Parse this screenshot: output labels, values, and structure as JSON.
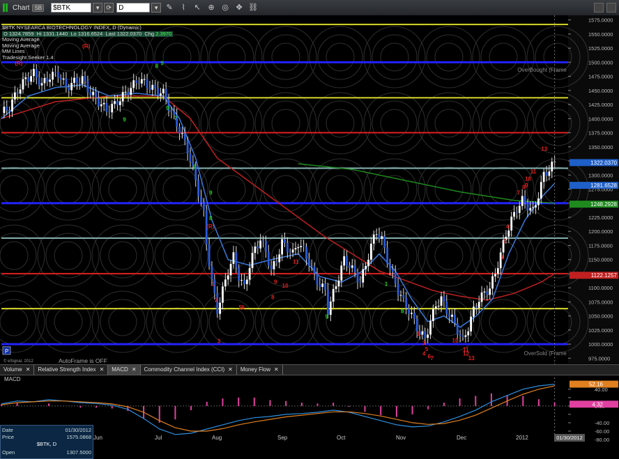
{
  "window": {
    "title": "Chart",
    "badge": "SB",
    "symbol": "$BTK",
    "interval": "D",
    "tools": [
      "pencil-icon",
      "brush-icon",
      "cursor-icon",
      "magnify-icon",
      "target-icon",
      "crosshair-icon",
      "link-icon"
    ]
  },
  "info_panel": {
    "header": "$BTK NYSEARCA BIOTECHNOLOGY INDEX, D (Dynamic)",
    "ohlc_labels": {
      "o": "O",
      "hi": "Hi",
      "lo": "Lo",
      "last": "Last",
      "chg": "Chg"
    },
    "ohlc_values": {
      "o": "1324.7859",
      "hi": "1331.1440",
      "lo": "1316.6524",
      "last": "1322.0370",
      "chg": "2.3970"
    },
    "studies": [
      "Moving Average",
      "Moving Average",
      "MM Lines",
      "Tradesight Seeker 1.4"
    ]
  },
  "annotations": {
    "overbought": "OverBought (Frame",
    "oversold": "OverSold (Frame",
    "autoframe": "AutoFrame is OFF",
    "copyright": "© eSignal, 2012",
    "p_button": "P"
  },
  "chart_data": [
    {
      "type": "candlestick",
      "title": "$BTK NYSEARCA BIOTECHNOLOGY INDEX, D (Dynamic)",
      "x_tick_labels": [
        "Jun",
        "Jul",
        "Aug",
        "Sep",
        "Oct",
        "Nov",
        "Dec",
        "2012"
      ],
      "y_ticks": [
        1575,
        1550,
        1525,
        1500,
        1475,
        1450,
        1425,
        1400,
        1375,
        1350,
        1325,
        1300,
        1275,
        1250,
        1225,
        1200,
        1175,
        1150,
        1125,
        1100,
        1075,
        1050,
        1025,
        1000,
        975
      ],
      "y_tick_labels": [
        "1575.0000",
        "1550.0000",
        "1525.0000",
        "1500.0000",
        "1475.0000",
        "1450.0000",
        "1425.0000",
        "1400.0000",
        "1375.0000",
        "1350.0000",
        "1325.0000",
        "1300.0000",
        "1275.0000",
        "1250.0000",
        "1225.0000",
        "1200.0000",
        "1175.0000",
        "1150.0000",
        "1125.0000",
        "1100.0000",
        "1075.0000",
        "1050.0000",
        "1025.0000",
        "1000.0000",
        "975.0000"
      ],
      "ylim": [
        968,
        1582
      ],
      "close_path": [
        [
          0,
          1410
        ],
        [
          3,
          1420
        ],
        [
          6,
          1450
        ],
        [
          9,
          1470
        ],
        [
          12,
          1480
        ],
        [
          15,
          1460
        ],
        [
          18,
          1475
        ],
        [
          21,
          1480
        ],
        [
          24,
          1455
        ],
        [
          27,
          1465
        ],
        [
          30,
          1470
        ],
        [
          33,
          1445
        ],
        [
          36,
          1430
        ],
        [
          39,
          1415
        ],
        [
          42,
          1425
        ],
        [
          45,
          1440
        ],
        [
          48,
          1455
        ],
        [
          51,
          1470
        ],
        [
          54,
          1460
        ],
        [
          57,
          1450
        ],
        [
          60,
          1445
        ],
        [
          63,
          1410
        ],
        [
          66,
          1380
        ],
        [
          69,
          1345
        ],
        [
          72,
          1290
        ],
        [
          75,
          1230
        ],
        [
          76,
          1180
        ],
        [
          78,
          1110
        ],
        [
          80,
          1060
        ],
        [
          82,
          1095
        ],
        [
          84,
          1130
        ],
        [
          86,
          1155
        ],
        [
          88,
          1120
        ],
        [
          90,
          1100
        ],
        [
          92,
          1140
        ],
        [
          94,
          1170
        ],
        [
          96,
          1185
        ],
        [
          98,
          1165
        ],
        [
          100,
          1130
        ],
        [
          102,
          1150
        ],
        [
          104,
          1180
        ],
        [
          106,
          1170
        ],
        [
          108,
          1160
        ],
        [
          110,
          1180
        ],
        [
          112,
          1165
        ],
        [
          114,
          1145
        ],
        [
          116,
          1120
        ],
        [
          118,
          1105
        ],
        [
          120,
          1095
        ],
        [
          121,
          1060
        ],
        [
          123,
          1090
        ],
        [
          125,
          1120
        ],
        [
          127,
          1150
        ],
        [
          129,
          1140
        ],
        [
          131,
          1125
        ],
        [
          133,
          1110
        ],
        [
          135,
          1140
        ],
        [
          137,
          1175
        ],
        [
          139,
          1200
        ],
        [
          141,
          1185
        ],
        [
          143,
          1150
        ],
        [
          145,
          1120
        ],
        [
          147,
          1095
        ],
        [
          149,
          1075
        ],
        [
          151,
          1060
        ],
        [
          153,
          1040
        ],
        [
          155,
          1020
        ],
        [
          157,
          1010
        ],
        [
          159,
          1040
        ],
        [
          161,
          1070
        ],
        [
          163,
          1080
        ],
        [
          165,
          1060
        ],
        [
          167,
          1045
        ],
        [
          169,
          1025
        ],
        [
          171,
          1005
        ],
        [
          173,
          1030
        ],
        [
          175,
          1060
        ],
        [
          177,
          1080
        ],
        [
          179,
          1090
        ],
        [
          181,
          1100
        ],
        [
          183,
          1125
        ],
        [
          185,
          1160
        ],
        [
          187,
          1195
        ],
        [
          189,
          1220
        ],
        [
          191,
          1240
        ],
        [
          193,
          1255
        ],
        [
          195,
          1245
        ],
        [
          197,
          1235
        ],
        [
          199,
          1265
        ],
        [
          201,
          1300
        ],
        [
          203,
          1310
        ],
        [
          205,
          1322
        ]
      ],
      "horizontal_lines": [
        {
          "value": 1567,
          "color": "#d9d92a"
        },
        {
          "value": 1500,
          "color": "#2222ff"
        },
        {
          "value": 1437,
          "color": "#d9d92a"
        },
        {
          "value": 1375,
          "color": "#e02020"
        },
        {
          "value": 1312,
          "color": "#88b4b4"
        },
        {
          "value": 1250,
          "color": "#2222ff"
        },
        {
          "value": 1188,
          "color": "#88b4b4"
        },
        {
          "value": 1125,
          "color": "#e02020"
        },
        {
          "value": 1063,
          "color": "#d9d92a"
        },
        {
          "value": 1000,
          "color": "#2222ff"
        }
      ],
      "moving_averages": [
        {
          "color": "#c02020",
          "points": [
            [
              0,
              1400
            ],
            [
              20,
              1430
            ],
            [
              40,
              1440
            ],
            [
              60,
              1440
            ],
            [
              70,
              1400
            ],
            [
              80,
              1330
            ],
            [
              100,
              1260
            ],
            [
              120,
              1190
            ],
            [
              140,
              1130
            ],
            [
              160,
              1095
            ],
            [
              170,
              1085
            ],
            [
              180,
              1078
            ],
            [
              190,
              1090
            ],
            [
              200,
              1110
            ],
            [
              205,
              1125
            ]
          ]
        },
        {
          "color": "#1e8a1e",
          "points": [
            [
              110,
              1320
            ],
            [
              130,
              1310
            ],
            [
              150,
              1290
            ],
            [
              170,
              1270
            ],
            [
              190,
              1255
            ],
            [
              205,
              1250
            ]
          ]
        },
        {
          "color": "#3a7ad8",
          "points": [
            [
              0,
              1400
            ],
            [
              10,
              1440
            ],
            [
              20,
              1455
            ],
            [
              30,
              1460
            ],
            [
              40,
              1440
            ],
            [
              50,
              1445
            ],
            [
              60,
              1440
            ],
            [
              66,
              1400
            ],
            [
              72,
              1330
            ],
            [
              78,
              1220
            ],
            [
              84,
              1150
            ],
            [
              92,
              1140
            ],
            [
              100,
              1150
            ],
            [
              110,
              1160
            ],
            [
              118,
              1120
            ],
            [
              126,
              1110
            ],
            [
              134,
              1130
            ],
            [
              140,
              1160
            ],
            [
              146,
              1130
            ],
            [
              152,
              1080
            ],
            [
              158,
              1040
            ],
            [
              164,
              1050
            ],
            [
              170,
              1030
            ],
            [
              176,
              1050
            ],
            [
              182,
              1080
            ],
            [
              188,
              1160
            ],
            [
              194,
              1220
            ],
            [
              200,
              1260
            ],
            [
              205,
              1285
            ]
          ]
        }
      ],
      "price_labels": [
        {
          "text": "1322.0370",
          "value": 1322.037,
          "bg": "#1f5fc8",
          "fg": "#ffffff"
        },
        {
          "text": "1281.6528",
          "value": 1281.6528,
          "bg": "#1f5fc8",
          "fg": "#ffffff"
        },
        {
          "text": "1248.2928",
          "value": 1248.2928,
          "bg": "#1e8a1e",
          "fg": "#ffffff"
        },
        {
          "text": "1122.1257",
          "value": 1122.1257,
          "bg": "#c02020",
          "fg": "#ffffff"
        }
      ],
      "seeker_counts": [
        {
          "text": "(R)",
          "x": 30,
          "value": 1525,
          "color": "#e02020"
        },
        {
          "text": "(R)",
          "x": 5,
          "value": 1495,
          "color": "#e02020"
        },
        {
          "text": "8",
          "x": 57,
          "value": 1490,
          "color": "#22cc22"
        },
        {
          "text": "9",
          "x": 59,
          "value": 1495,
          "color": "#22cc22"
        },
        {
          "text": "7",
          "x": 64,
          "value": 1397,
          "color": "#22cc22"
        },
        {
          "text": "9",
          "x": 45,
          "value": 1395,
          "color": "#22cc22"
        },
        {
          "text": "9",
          "x": 61,
          "value": 1415,
          "color": "#22cc22"
        },
        {
          "text": "9",
          "x": 71,
          "value": 1311,
          "color": "#22cc22"
        },
        {
          "text": "9",
          "x": 77,
          "value": 1265,
          "color": "#22cc22"
        },
        {
          "text": "8",
          "x": 77,
          "value": 1220,
          "color": "#22cc22"
        },
        {
          "text": "(R)",
          "x": 76,
          "value": 1205,
          "color": "#e02020"
        },
        {
          "text": "1",
          "x": 78,
          "value": 1103,
          "color": "#e02020"
        },
        {
          "text": "2",
          "x": 79,
          "value": 1075,
          "color": "#e02020"
        },
        {
          "text": "3",
          "x": 80,
          "value": 1002,
          "color": "#e02020"
        },
        {
          "text": "5",
          "x": 88,
          "value": 1062,
          "color": "#e02020"
        },
        {
          "text": "6",
          "x": 89,
          "value": 1062,
          "color": "#e02020"
        },
        {
          "text": "8",
          "x": 100,
          "value": 1080,
          "color": "#e02020"
        },
        {
          "text": "9",
          "x": 101,
          "value": 1107,
          "color": "#e02020"
        },
        {
          "text": "10",
          "x": 104,
          "value": 1100,
          "color": "#e02020"
        },
        {
          "text": "11",
          "x": 108,
          "value": 1143,
          "color": "#e02020"
        },
        {
          "text": "9",
          "x": 120,
          "value": 1045,
          "color": "#22cc22"
        },
        {
          "text": "1",
          "x": 142,
          "value": 1103,
          "color": "#22cc22"
        },
        {
          "text": "8",
          "x": 148,
          "value": 1055,
          "color": "#22cc22"
        },
        {
          "text": "1",
          "x": 154,
          "value": 1015,
          "color": "#e02020"
        },
        {
          "text": "3",
          "x": 156,
          "value": 998,
          "color": "#e02020"
        },
        {
          "text": "5",
          "x": 157,
          "value": 988,
          "color": "#e02020"
        },
        {
          "text": "4",
          "x": 156,
          "value": 980,
          "color": "#e02020"
        },
        {
          "text": "6",
          "x": 158,
          "value": 975,
          "color": "#e02020"
        },
        {
          "text": "7",
          "x": 159,
          "value": 972,
          "color": "#e02020"
        },
        {
          "text": "10",
          "x": 167,
          "value": 1003,
          "color": "#e02020"
        },
        {
          "text": "11",
          "x": 171,
          "value": 987,
          "color": "#e02020"
        },
        {
          "text": "12",
          "x": 171,
          "value": 980,
          "color": "#e02020"
        },
        {
          "text": "13",
          "x": 173,
          "value": 972,
          "color": "#e02020"
        },
        {
          "text": "1",
          "x": 185,
          "value": 1150,
          "color": "#e02020"
        },
        {
          "text": "3",
          "x": 186,
          "value": 1180,
          "color": "#e02020"
        },
        {
          "text": "4",
          "x": 187,
          "value": 1205,
          "color": "#e02020"
        },
        {
          "text": "7",
          "x": 191,
          "value": 1265,
          "color": "#e02020"
        },
        {
          "text": "8",
          "x": 193,
          "value": 1275,
          "color": "#e02020"
        },
        {
          "text": "9",
          "x": 194,
          "value": 1278,
          "color": "#e02020"
        },
        {
          "text": "10",
          "x": 194,
          "value": 1290,
          "color": "#e02020"
        },
        {
          "text": "11",
          "x": 196,
          "value": 1303,
          "color": "#e02020"
        },
        {
          "text": "13",
          "x": 200,
          "value": 1343,
          "color": "#e02020"
        }
      ]
    },
    {
      "type": "line",
      "title": "MACD",
      "series": [
        {
          "color": "#2f8fe0",
          "values": [
            5,
            12,
            10,
            15,
            12,
            8,
            6,
            2,
            -8,
            -30,
            -55,
            -68,
            -65,
            -55,
            -45,
            -35,
            -28,
            -25,
            -20,
            -18,
            -15,
            -10,
            -15,
            -25,
            -35,
            -45,
            -50,
            -48,
            -38,
            -25,
            -10,
            10,
            25,
            40,
            48,
            52
          ]
        },
        {
          "color": "#e08020",
          "values": [
            3,
            8,
            10,
            12,
            12,
            10,
            8,
            5,
            -2,
            -15,
            -35,
            -52,
            -60,
            -60,
            -54,
            -45,
            -38,
            -32,
            -26,
            -22,
            -18,
            -14,
            -14,
            -18,
            -24,
            -32,
            -40,
            -44,
            -42,
            -34,
            -22,
            -5,
            12,
            28,
            40,
            48
          ]
        }
      ],
      "histogram_color": "#e040a0",
      "y_ticks": [
        40,
        20,
        0,
        -20,
        -40,
        -60,
        -80
      ],
      "y_tick_labels": [
        "40.00",
        "",
        "0.00",
        "",
        "-40.00",
        "-60.00",
        "-80.00"
      ],
      "ylim": [
        -90,
        58
      ],
      "price_labels": [
        {
          "text": "52.16",
          "value": 52.16,
          "bg": "#e08020",
          "fg": "#ffffff"
        },
        {
          "text": "4.32",
          "value": 4.32,
          "bg": "#e040a0",
          "fg": "#ffffff"
        }
      ]
    }
  ],
  "x_axis": {
    "date_box": "01/30/2012"
  },
  "study_tabs": [
    {
      "label": "Volume",
      "active": false
    },
    {
      "label": "Relative Strength Index",
      "active": false
    },
    {
      "label": "MACD",
      "active": true
    },
    {
      "label": "Commodity Channel Index (CCI)",
      "active": false
    },
    {
      "label": "Money Flow",
      "active": false
    }
  ],
  "macd_label": "MACD",
  "data_window": {
    "date_label": "Date",
    "date_value": "01/30/2012",
    "price_label": "Price",
    "price_value": "1575.0868",
    "symbol_line": "$BTK, D",
    "open_label": "Open",
    "open_value": "1307.5000"
  }
}
